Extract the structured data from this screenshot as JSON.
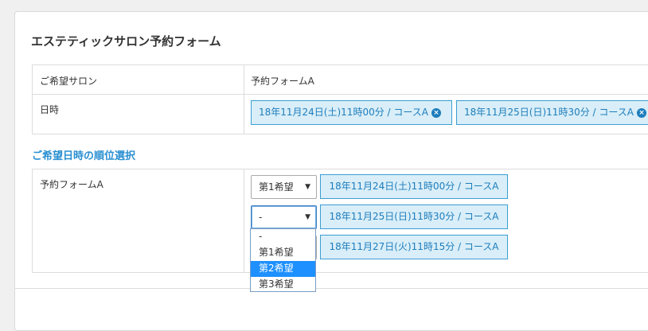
{
  "form": {
    "title": "エステティックサロン予約フォーム"
  },
  "summary_table": {
    "rows": [
      {
        "label": "ご希望サロン",
        "value": "予約フォームA"
      },
      {
        "label": "日時"
      }
    ],
    "chips": [
      {
        "label": "18年11月24日(土)11時00分 / コースA",
        "close_icon": "×"
      },
      {
        "label": "18年11月25日(日)11時30分 / コースA",
        "close_icon": "×"
      }
    ]
  },
  "priority_section": {
    "title": "ご希望日時の順位選択",
    "form_name": "予約フォームA",
    "entries": [
      {
        "selected": "第1希望",
        "slot": "18年11月24日(土)11時00分 / コースA"
      },
      {
        "selected": "-",
        "slot": "18年11月25日(日)11時30分 / コースA"
      },
      {
        "selected": "",
        "slot": "18年11月27日(火)11時15分 / コースA"
      }
    ],
    "dropdown_options": [
      "-",
      "第1希望",
      "第2希望",
      "第3希望"
    ],
    "highlighted_option": "第2希望",
    "arrow_glyph": "▼"
  },
  "colors": {
    "accent": "#2a8fd1",
    "chip_bg": "#d9eef8",
    "chip_border": "#3b9ed3",
    "highlight": "#1e90ff"
  }
}
